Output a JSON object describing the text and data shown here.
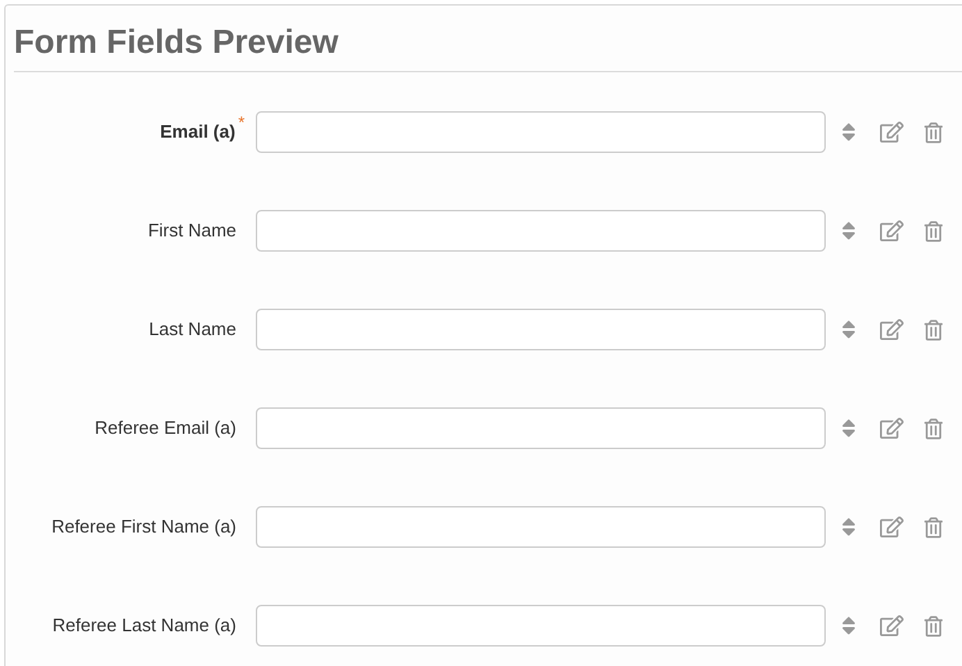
{
  "title": "Form Fields Preview",
  "fields": [
    {
      "label": "Email (a)",
      "required": true,
      "required_mark": "*"
    },
    {
      "label": "First Name",
      "required": false
    },
    {
      "label": "Last Name",
      "required": false
    },
    {
      "label": "Referee Email (a)",
      "required": false
    },
    {
      "label": "Referee First Name (a)",
      "required": false
    },
    {
      "label": "Referee Last Name (a)",
      "required": false
    }
  ]
}
